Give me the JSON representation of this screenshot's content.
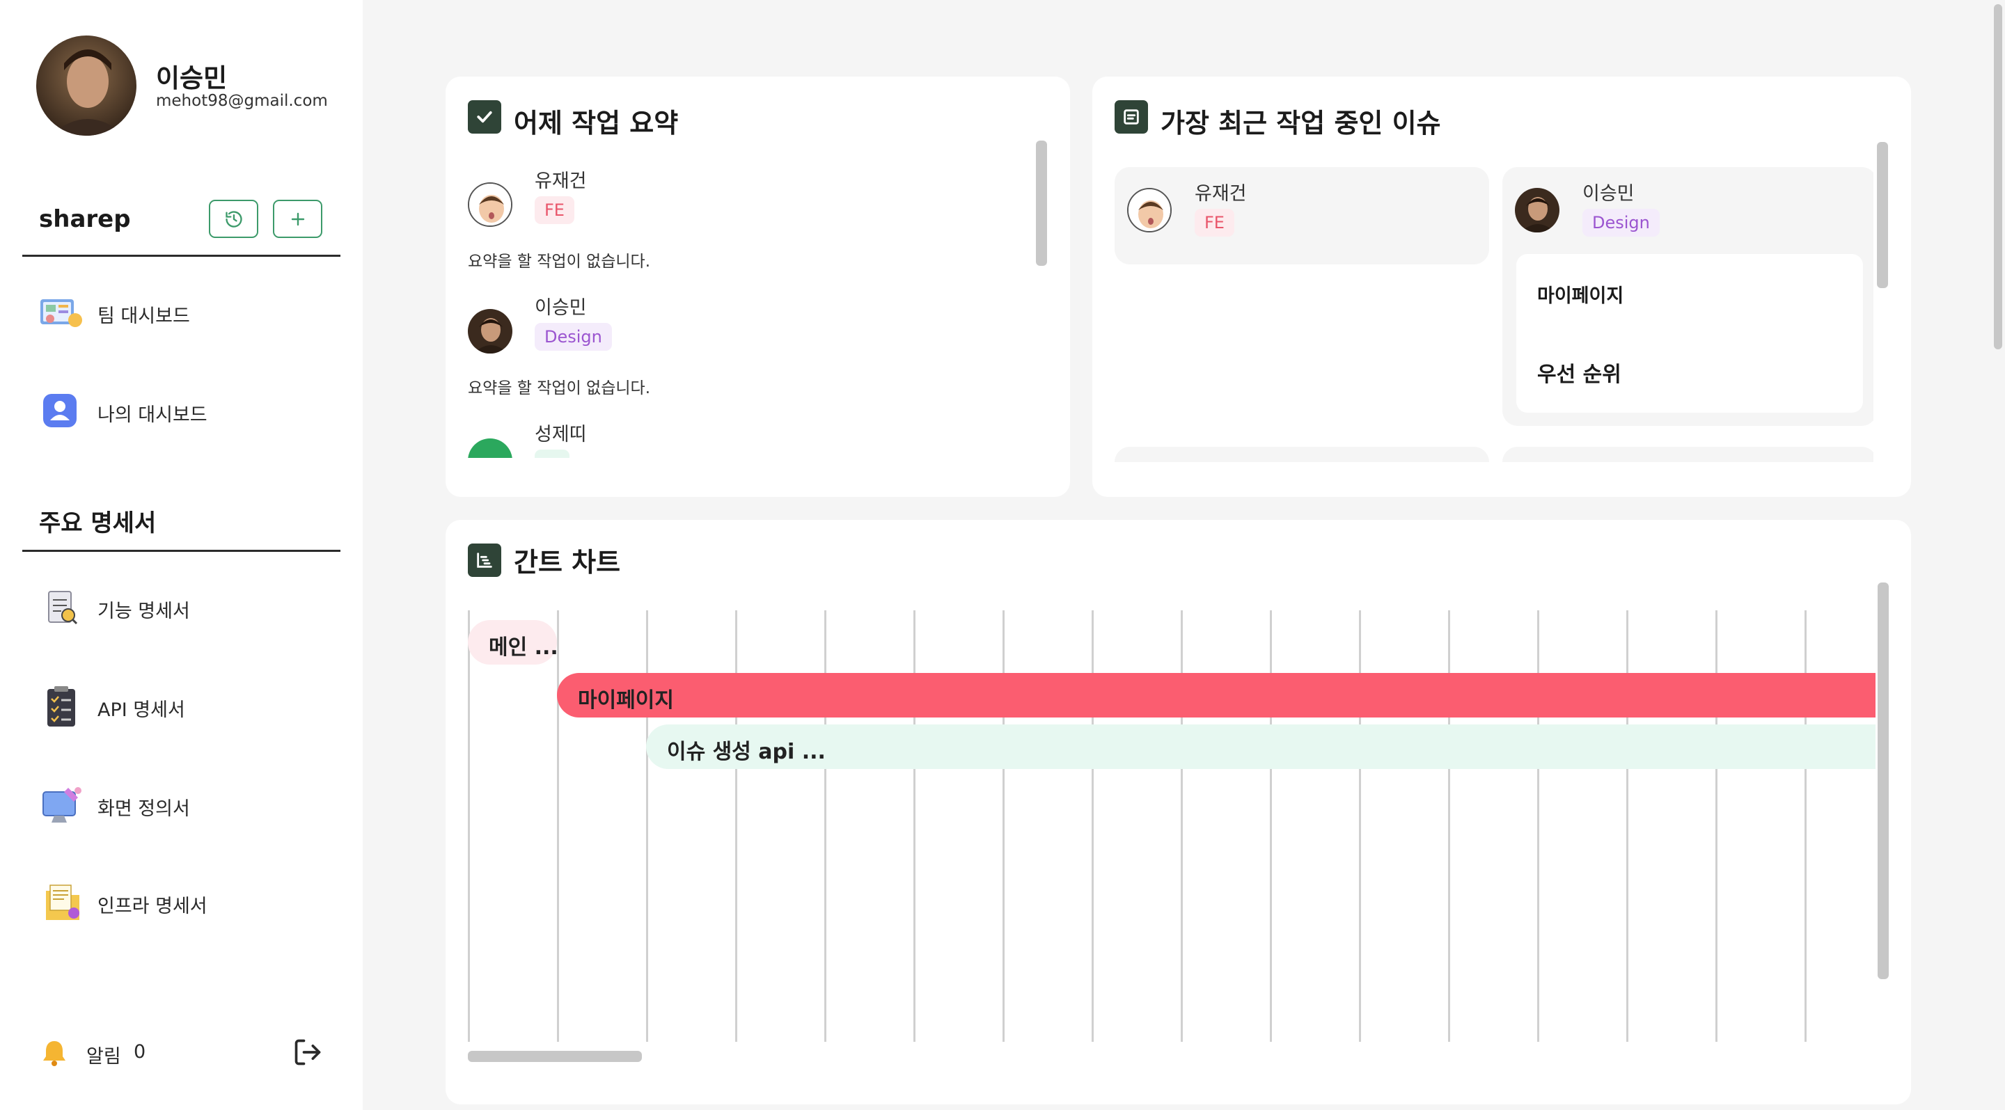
{
  "user": {
    "name": "이승민",
    "email": "mehot98@gmail.com"
  },
  "project": {
    "name": "sharep",
    "history_icon": "history-icon",
    "add_icon": "plus-icon"
  },
  "nav": [
    {
      "label": "팀 대시보드",
      "icon": "team-dashboard-icon"
    },
    {
      "label": "나의 대시보드",
      "icon": "my-dashboard-icon"
    }
  ],
  "specs": {
    "title": "주요 명세서",
    "items": [
      {
        "label": "기능 명세서",
        "icon": "feature-spec-icon"
      },
      {
        "label": "API 명세서",
        "icon": "api-spec-icon"
      },
      {
        "label": "화면 정의서",
        "icon": "screen-def-icon"
      },
      {
        "label": "인프라 명세서",
        "icon": "infra-spec-icon"
      }
    ]
  },
  "footer": {
    "alarm_label": "알림",
    "alarm_count": "0",
    "logout_icon": "logout-icon"
  },
  "summary": {
    "title": "어제 작업 요약",
    "members": [
      {
        "name": "유재건",
        "tag": "FE",
        "text": "요약을 할 작업이 없습니다."
      },
      {
        "name": "이승민",
        "tag": "Design",
        "text": "요약을 할 작업이 없습니다."
      },
      {
        "name": "성제띠",
        "tag": "",
        "text": ""
      }
    ]
  },
  "recent": {
    "title": "가장 최근 작업 중인 이슈",
    "members": [
      {
        "name": "유재건",
        "tag": "FE",
        "issues": []
      },
      {
        "name": "이승민",
        "tag": "Design",
        "issues": [
          "마이페이지",
          "우선 순위"
        ]
      }
    ]
  },
  "gantt": {
    "title": "간트 차트",
    "bars": [
      {
        "label": "메인 ...",
        "color": "#fdebee"
      },
      {
        "label": "마이페이지",
        "color": "#fb5d70"
      },
      {
        "label": "이슈 생성 api ...",
        "color": "#e7f8f1"
      }
    ]
  },
  "colors": {
    "accent_green": "#3c9a6a",
    "dark_green": "#2f4437",
    "fe_red": "#e9566b",
    "design_purple": "#9b55d0"
  }
}
